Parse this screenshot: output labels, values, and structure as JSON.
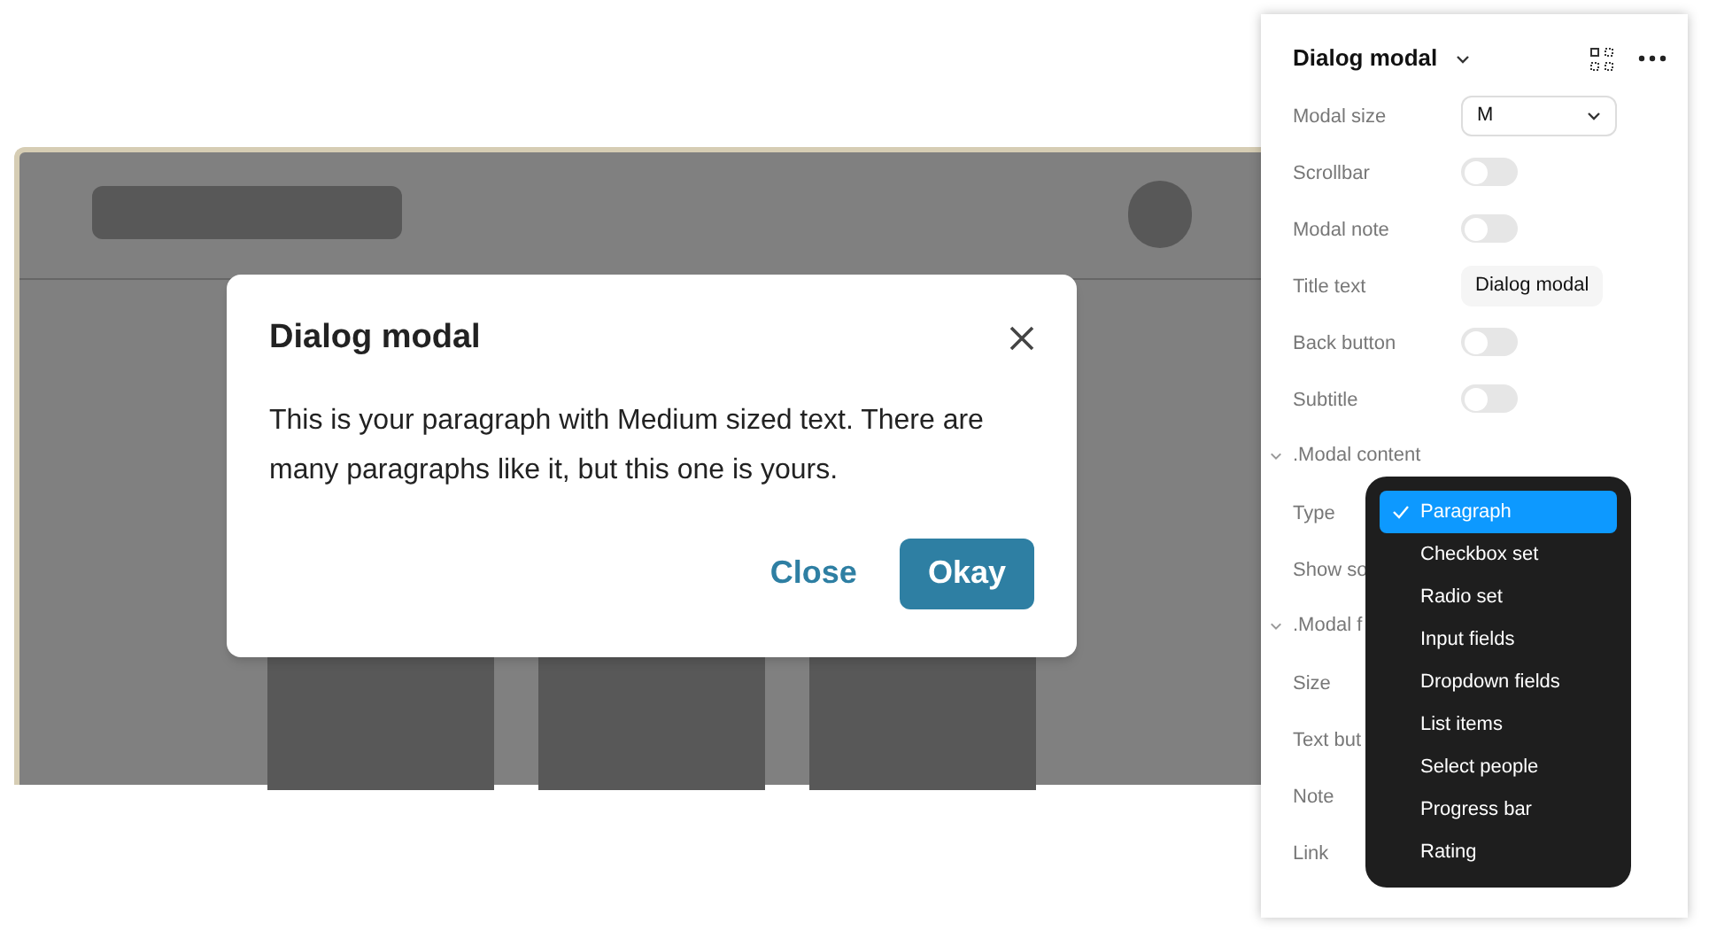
{
  "dialog": {
    "title": "Dialog modal",
    "paragraph": "This is your paragraph with Medium sized text. There are many paragraphs like it, but this one is yours.",
    "buttons": [
      {
        "label": "Close",
        "kind": "text"
      },
      {
        "label": "Okay",
        "kind": "primary"
      }
    ]
  },
  "panel": {
    "title": "Dialog modal",
    "rows": [
      {
        "kind": "select",
        "label": "Modal size",
        "value": "M"
      },
      {
        "kind": "toggle",
        "label": "Scrollbar",
        "on": false
      },
      {
        "kind": "toggle",
        "label": "Modal note",
        "on": false
      },
      {
        "kind": "text",
        "label": "Title text",
        "value": "Dialog modal"
      },
      {
        "kind": "toggle",
        "label": "Back button",
        "on": false
      },
      {
        "kind": "toggle",
        "label": "Subtitle",
        "on": false
      },
      {
        "kind": "section",
        "label": ".Modal content",
        "expanded": true
      },
      {
        "kind": "label",
        "label": "Type"
      },
      {
        "kind": "label",
        "label": "Show so"
      },
      {
        "kind": "section",
        "label": ".Modal f",
        "expanded": true
      },
      {
        "kind": "label",
        "label": "Size"
      },
      {
        "kind": "label",
        "label": "Text but"
      },
      {
        "kind": "label",
        "label": "Note"
      },
      {
        "kind": "label",
        "label": "Link"
      }
    ]
  },
  "menu": {
    "items": [
      {
        "label": "Paragraph",
        "selected": true
      },
      {
        "label": "Checkbox set",
        "selected": false
      },
      {
        "label": "Radio set",
        "selected": false
      },
      {
        "label": "Input fields",
        "selected": false
      },
      {
        "label": "Dropdown fields",
        "selected": false
      },
      {
        "label": "List items",
        "selected": false
      },
      {
        "label": "Select people",
        "selected": false
      },
      {
        "label": "Progress bar",
        "selected": false
      },
      {
        "label": "Rating",
        "selected": false
      }
    ]
  }
}
